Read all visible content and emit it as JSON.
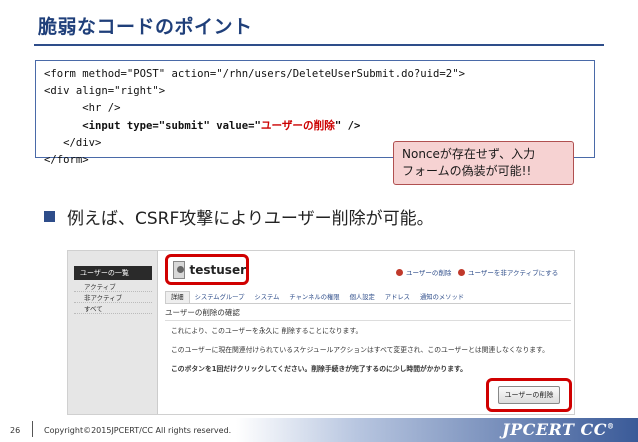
{
  "slide": {
    "title": "脆弱なコードのポイント",
    "code_lines": [
      "<form method=\"POST\" action=\"/rhn/users/DeleteUserSubmit.do?uid=2\">",
      "<div align=\"right\">",
      "      <hr />",
      "      <input type=\"submit\" value=\"",
      "ユーザーの削除",
      "\" />",
      "   </div>",
      "</form>"
    ],
    "callout": {
      "line1": "Nonceが存在せず、入力",
      "line2": "フォームの偽装が可能!!"
    },
    "bullet": "例えば、CSRF攻撃によりユーザー削除が可能。"
  },
  "screenshot": {
    "sidebar": {
      "header": "ユーザーの一覧",
      "items": [
        "アクティブ",
        "非アクティブ",
        "すべて"
      ]
    },
    "user_name": "testuser",
    "top_links": [
      "ユーザーの削除",
      "ユーザーを非アクティブにする"
    ],
    "tabs": [
      "詳細",
      "システムグループ",
      "システム",
      "チャンネルの権限",
      "個人設定",
      "アドレス",
      "通知のメソッド"
    ],
    "section_title": "ユーザーの削除の確認",
    "desc_lines": [
      "これにより、このユーザーを永久に 削除することになります。",
      "このユーザーに現在関連付けられているスケジュールアクションはすべて変更され、このユーザーとは関連しなくなります。",
      "このボタンを1回だけクリックしてください。削除手続きが完了するのに少し時間がかかります。"
    ],
    "delete_button": "ユーザーの削除"
  },
  "footer": {
    "page_number": "26",
    "copyright": "Copyright©2015JPCERT/CC All rights reserved.",
    "logo": "JPCERT CC",
    "logo_mark": "®"
  },
  "colors": {
    "title": "#1f3f7a",
    "accent_red": "#d00000",
    "callout_bg": "#f6d2d2",
    "brand_blue": "#2e4d8a"
  }
}
